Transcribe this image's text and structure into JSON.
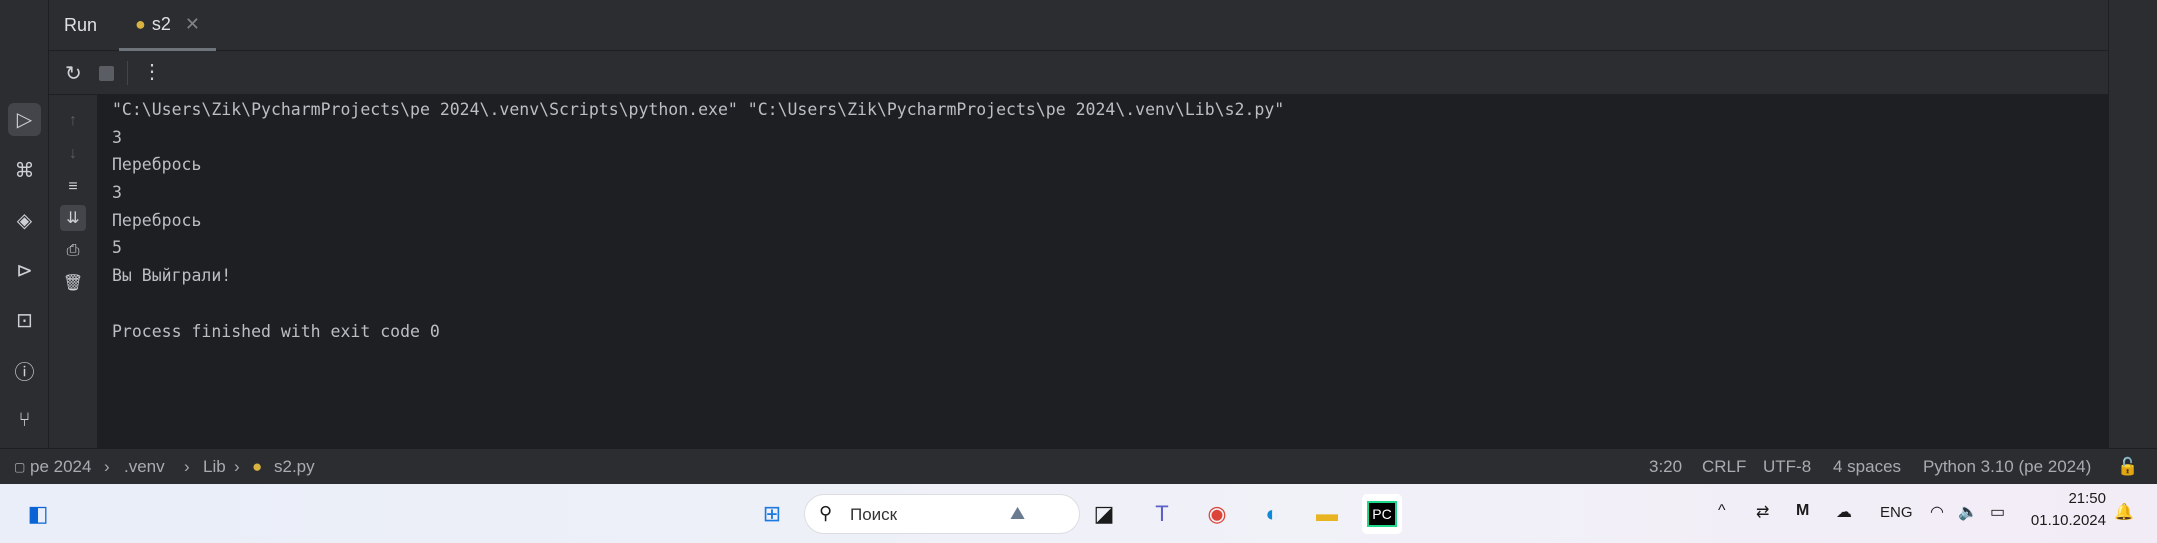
{
  "tool_window": {
    "title": "Run",
    "tab_label": "s2"
  },
  "console": {
    "lines": [
      "\"C:\\Users\\Zik\\PycharmProjects\\pe 2024\\.venv\\Scripts\\python.exe\" \"C:\\Users\\Zik\\PycharmProjects\\pe 2024\\.venv\\Lib\\s2.py\"",
      "3",
      "Перебрось",
      "3",
      "Перебрось",
      "5",
      "Вы Выйграли!",
      "",
      "Process finished with exit code 0"
    ]
  },
  "breadcrumb": {
    "items": [
      "pe 2024",
      ".venv",
      "Lib",
      "s2.py"
    ]
  },
  "status": {
    "position": "3:20",
    "line_sep": "CRLF",
    "encoding": "UTF-8",
    "indent": "4 spaces",
    "interpreter": "Python 3.10 (pe 2024)"
  },
  "taskbar": {
    "search_placeholder": "Поиск",
    "lang": "ENG",
    "time": "21:50",
    "date": "01.10.2024"
  }
}
